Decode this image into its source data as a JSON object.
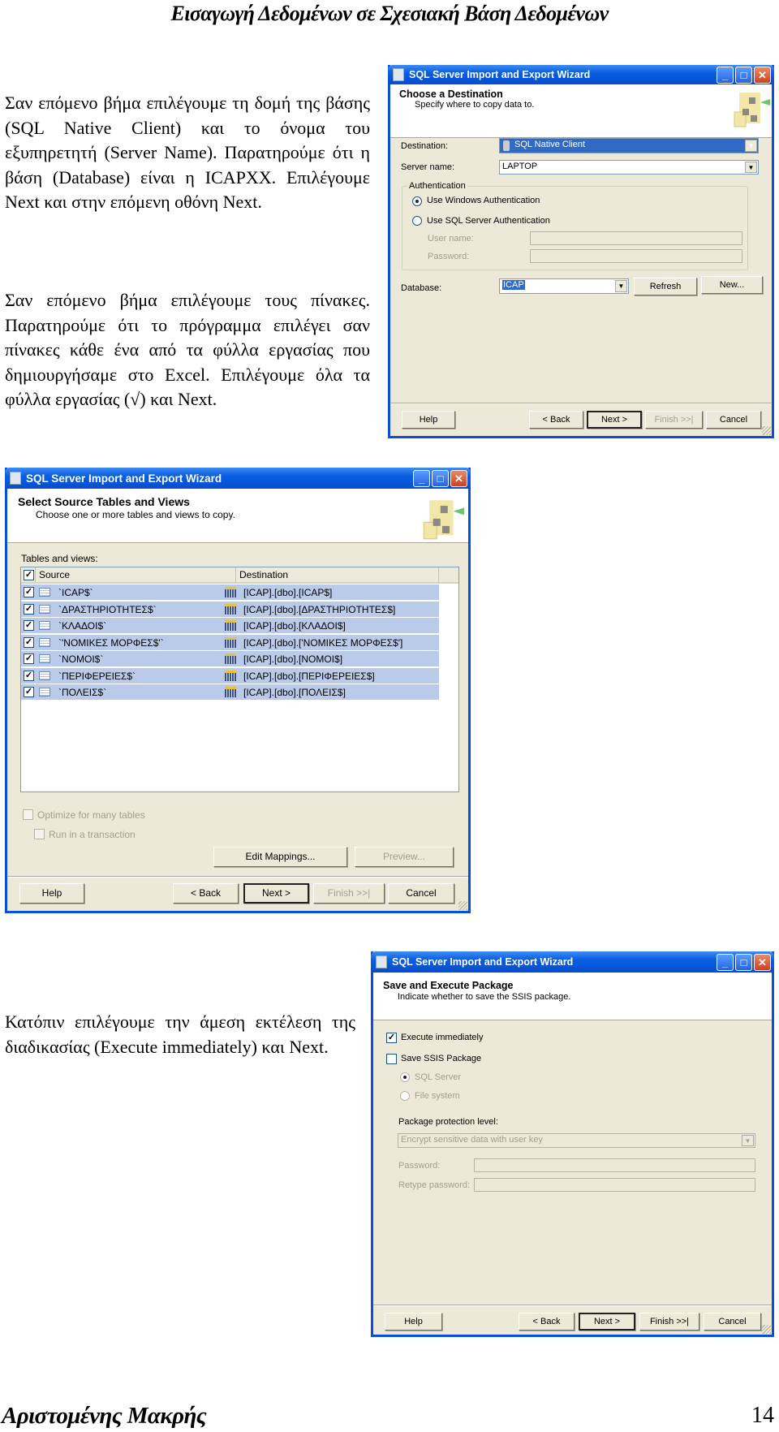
{
  "page": {
    "header": "Εισαγωγή Δεδομένων σε Σχεσιακή Βάση Δεδομένων",
    "paragraphs": [
      "Σαν επόμενο βήμα επιλέγουμε τη δομή της βάσης (SQL Native Client) και το όνομα του εξυπηρετητή (Server Name). Παρατηρούμε ότι η βάση (Database) είναι η ICAPXX. Επιλέγουμε Next και στην επόμενη οθόνη Next.",
      "Σαν επόμενο βήμα επιλέγουμε τους πίνακες. Παρατηρούμε ότι το πρόγραμμα επιλέγει σαν πίνακες κάθε ένα από τα φύλλα εργασίας που δημιουργήσαμε στο Excel. Επιλέγουμε όλα τα φύλλα εργασίας (√) και Next.",
      "Κατόπιν επιλέγουμε την άμεση εκτέλεση της διαδικασίας (Execute immediately) και Next."
    ],
    "footer_author": "Αριστομένης Μακρής",
    "page_number": "14"
  },
  "window_title": "SQL Server Import and Export Wizard",
  "window_buttons": {
    "minimize": "_",
    "maximize": "□",
    "close": "✕"
  },
  "colors": {
    "titlebar": "#0a5ee0",
    "dialog_bg": "#ece9d8",
    "row_selected": "#bacbe9"
  },
  "dialog1": {
    "title": "Choose a Destination",
    "subtitle": "Specify where to copy data to.",
    "destination_label": "Destination:",
    "destination_value": "SQL Native Client",
    "server_label": "Server name:",
    "server_value": "LAPTOP",
    "auth_group": "Authentication",
    "auth_windows": "Use Windows Authentication",
    "auth_sql": "Use SQL Server Authentication",
    "auth_selected": "windows",
    "username_label": "User name:",
    "password_label": "Password:",
    "database_label": "Database:",
    "database_value": "ICAP",
    "refresh": "Refresh",
    "new": "New...",
    "buttons": {
      "help": "Help",
      "back": "< Back",
      "next": "Next >",
      "finish": "Finish >>|",
      "cancel": "Cancel"
    }
  },
  "dialog2": {
    "title": "Select Source Tables and Views",
    "subtitle": "Choose one or more tables and views to copy.",
    "tables_label": "Tables and views:",
    "col_source": "Source",
    "col_destination": "Destination",
    "rows": [
      {
        "source": "`ICAP$`",
        "destination": "[ICAP].[dbo].[ICAP$]",
        "checked": true
      },
      {
        "source": "`ΔΡΑΣΤΗΡΙΟΤΗΤΕΣ$`",
        "destination": "[ICAP].[dbo].[ΔΡΑΣΤΗΡΙΟΤΗΤΕΣ$]",
        "checked": true
      },
      {
        "source": "`ΚΛΑΔΟΙ$`",
        "destination": "[ICAP].[dbo].[ΚΛΑΔΟΙ$]",
        "checked": true
      },
      {
        "source": "`'ΝΟΜΙΚΕΣ ΜΟΡΦΕΣ$'`",
        "destination": "[ICAP].[dbo].['ΝΟΜΙΚΕΣ ΜΟΡΦΕΣ$']",
        "checked": true
      },
      {
        "source": "`ΝΟΜΟΙ$`",
        "destination": "[ICAP].[dbo].[ΝΟΜΟΙ$]",
        "checked": true
      },
      {
        "source": "`ΠΕΡΙΦΕΡΕΙΕΣ$`",
        "destination": "[ICAP].[dbo].[ΠΕΡΙΦΕΡΕΙΕΣ$]",
        "checked": true
      },
      {
        "source": "`ΠΟΛΕΙΣ$`",
        "destination": "[ICAP].[dbo].[ΠΟΛΕΙΣ$]",
        "checked": true
      }
    ],
    "optimize": "Optimize for many tables",
    "transaction": "Run in a transaction",
    "edit_mappings": "Edit Mappings...",
    "preview": "Preview...",
    "buttons": {
      "help": "Help",
      "back": "< Back",
      "next": "Next >",
      "finish": "Finish >>|",
      "cancel": "Cancel"
    }
  },
  "dialog3": {
    "title": "Save and Execute Package",
    "subtitle": "Indicate whether to save the SSIS package.",
    "execute": "Execute immediately",
    "execute_checked": true,
    "save": "Save SSIS Package",
    "save_checked": false,
    "sql_server": "SQL Server",
    "file_system": "File system",
    "protection_label": "Package protection level:",
    "protection_value": "Encrypt sensitive data with user key",
    "password_label": "Password:",
    "retype_label": "Retype password:",
    "buttons": {
      "help": "Help",
      "back": "< Back",
      "next": "Next >",
      "finish": "Finish >>|",
      "cancel": "Cancel"
    }
  }
}
